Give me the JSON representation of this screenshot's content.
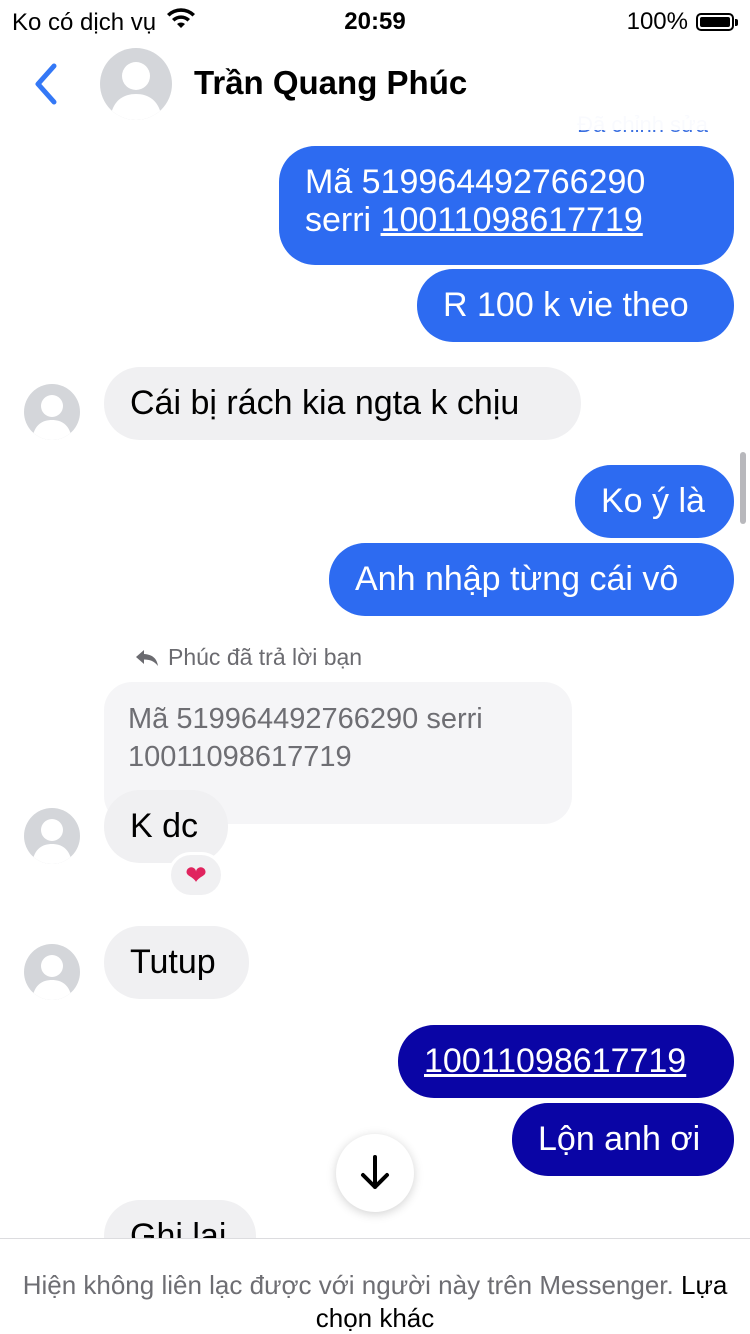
{
  "status_bar": {
    "carrier": "Ko có dịch vụ",
    "time": "20:59",
    "battery": "100%",
    "battery_level": 1.0
  },
  "header": {
    "contact_name": "Trần Quang Phúc"
  },
  "edited_label": "Đã chỉnh sửa",
  "messages": {
    "m1_line1": "Mã 519964492766290",
    "m1_line2_prefix": "serri ",
    "m1_line2_link": "10011098617719",
    "m2": "R 100 k vie theo",
    "m3": "Cái bị rách kia ngta k chịu",
    "m4": "Ko ý là",
    "m5": "Anh nhập từng cái vô",
    "reply_note": "Phúc đã trả lời bạn",
    "quoted_text": "Mã 519964492766290 serri 10011098617719",
    "m6": "K dc",
    "m6_reaction": "❤",
    "m7": "Tutup",
    "m8_link": "10011098617719",
    "m9": "Lộn anh ơi",
    "m10_partial": "Ghi lại"
  },
  "footer": {
    "text": "Hiện không liên lạc được với người này trên Messenger.",
    "link": "Lựa chọn khác"
  },
  "colors": {
    "outgoing_bubble": "#2d6bf1",
    "outgoing_bubble_recent": "#0a05a5",
    "incoming_bubble": "#f0f0f2",
    "accent": "#3478f6"
  },
  "icons": {
    "back": "chevron-left-icon",
    "wifi": "wifi-icon",
    "battery": "battery-icon",
    "reply": "reply-arrow-icon",
    "scroll_down": "arrow-down-icon"
  }
}
